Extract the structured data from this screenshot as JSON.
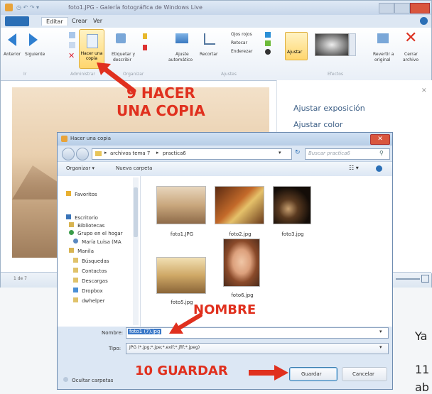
{
  "bg_window": {
    "title": "foto1.JPG - Galería fotográfica de Windows Live",
    "tabs": [
      "Editar",
      "Crear",
      "Ver"
    ],
    "ribbon": {
      "nav_anterior": "Anterior",
      "nav_siguiente": "Siguiente",
      "hacer_copia": "Hacer una copia",
      "etiquetar": "Etiquetar y",
      "etiquetar2": "describir",
      "ajuste_auto": "Ajuste",
      "ajuste_auto2": "automático",
      "recortar": "Recortar",
      "ojos_rojos": "Ojos rojos",
      "retocar": "Retocar",
      "enderezar": "Enderezar",
      "ajustar": "Ajustar",
      "revertir": "Revertir a",
      "revertir2": "original",
      "cerrar_archivo": "Cerrar",
      "cerrar_archivo2": "archivo",
      "groups": [
        "Ir",
        "Administrar",
        "Organizar",
        "Ajustes",
        "Efectos"
      ]
    },
    "right_panel": [
      "Ajustar exposición",
      "Ajustar color"
    ],
    "status_left": "1 de 7"
  },
  "annotations": {
    "step9_line1": "9 HACER",
    "step9_line2": "UNA COPIA",
    "nombre": "NOMBRE",
    "step10": "10 GUARDAR"
  },
  "dialog": {
    "title": "Hacer una copia",
    "path": [
      "archivos tema 7",
      "practica6"
    ],
    "search_placeholder": "Buscar practica6",
    "organize": "Organizar",
    "new_folder": "Nueva carpeta",
    "nav": [
      "Favoritos",
      "Escritorio",
      "Bibliotecas",
      "Grupo en el hogar",
      "María Luisa (MA",
      "Manila",
      "Búsquedas",
      "Contactos",
      "Descargas",
      "Dropbox",
      "dwhelper"
    ],
    "files": [
      "foto1.JPG",
      "foto2.jpg",
      "foto3.jpg",
      "foto5.jpg",
      "foto6.jpg"
    ],
    "nombre_label": "Nombre:",
    "nombre_value": "foto1 (7).jpg",
    "tipo_label": "Tipo:",
    "tipo_value": "JPG (*.jpg;*.jpe;*.exif;*.jfif;*.jpeg)",
    "hide_folders": "Ocultar carpetas",
    "save": "Guardar",
    "cancel": "Cancelar"
  },
  "page_text": {
    "ya": "Ya",
    "eleven": "11",
    "ab": "ab"
  },
  "colors": {
    "accent_red": "#e0301e",
    "win_blue": "#2b6fb6"
  }
}
